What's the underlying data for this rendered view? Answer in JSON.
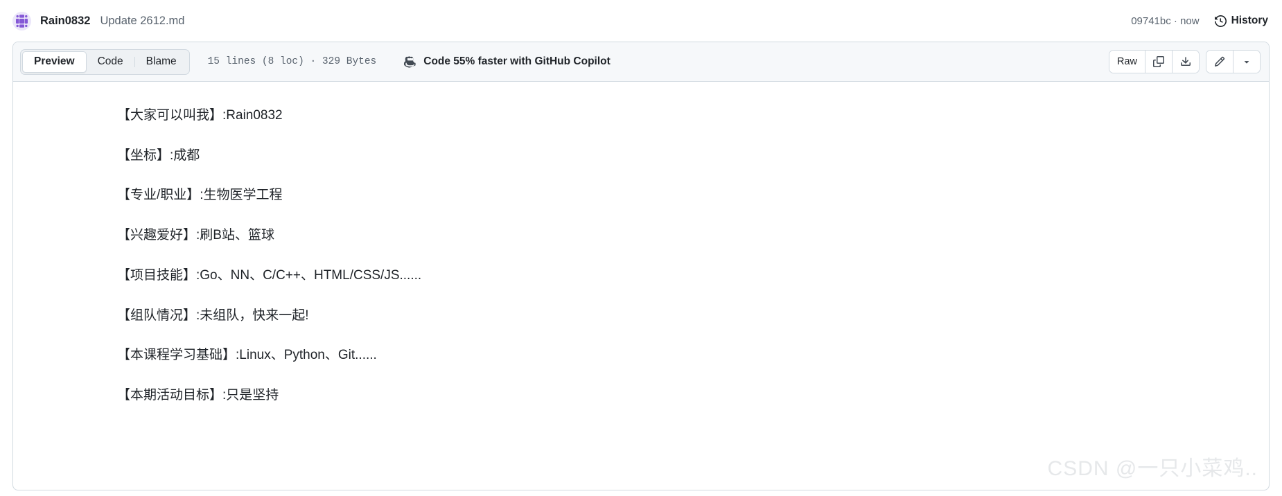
{
  "commit_header": {
    "avatar_icon": "user-avatar-identicon",
    "author": "Rain0832",
    "message": "Update 2612.md",
    "commit_meta": "09741bc · now",
    "history_label": "History",
    "history_icon": "history-clock-icon"
  },
  "file_toolbar": {
    "tabs": [
      {
        "label": "Preview",
        "active": true
      },
      {
        "label": "Code",
        "active": false
      },
      {
        "label": "Blame",
        "active": false
      }
    ],
    "file_stats": "15 lines (8 loc) · 329 Bytes",
    "copilot_cta": {
      "label": "Code 55% faster with GitHub Copilot",
      "icon": "copilot-icon"
    },
    "actions": {
      "raw_label": "Raw",
      "copy_icon": "copy-icon",
      "download_icon": "download-icon",
      "edit_icon": "pencil-edit-icon",
      "more_icon": "chevron-down-icon"
    }
  },
  "markdown": {
    "paragraphs": [
      "【大家可以叫我】:Rain0832",
      "【坐标】:成都",
      "【专业/职业】:生物医学工程",
      "【兴趣爱好】:刷B站、篮球",
      "【项目技能】:Go、NN、C/C++、HTML/CSS/JS......",
      "【组队情况】:未组队，快来一起!",
      "【本课程学习基础】:Linux、Python、Git......",
      "【本期活动目标】:只是坚持"
    ]
  },
  "watermark": {
    "text": "CSDN @一只小菜鸡.."
  },
  "colors": {
    "text_primary": "#1f2328",
    "text_muted": "#59636e",
    "border": "#d1d9e0",
    "toolbar_bg": "#f6f8fa",
    "tabs_bg": "#eef1f4",
    "avatar_accent": "#8b5cf6",
    "watermark": "#e6e8ea"
  }
}
